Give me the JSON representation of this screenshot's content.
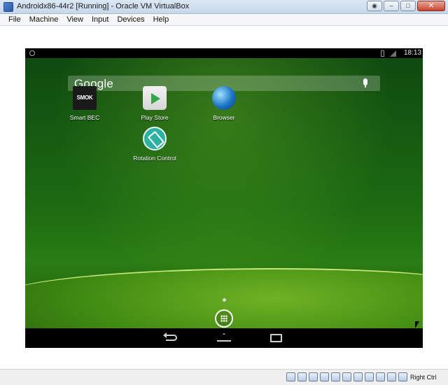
{
  "window": {
    "title": "Androidx86-44r2 [Running] - Oracle VM VirtualBox",
    "buttons": [
      "restore-icon",
      "minimize-icon",
      "maximize-icon",
      "close-icon"
    ]
  },
  "menubar": {
    "items": [
      "File",
      "Machine",
      "View",
      "Input",
      "Devices",
      "Help"
    ]
  },
  "android": {
    "status_bar": {
      "time": "18:13"
    },
    "search": {
      "logo_text": "Google"
    },
    "apps": [
      {
        "label": "Smart BEC",
        "icon_text": "SMOK",
        "icon": "smok-icon"
      },
      {
        "label": "Play Store",
        "icon": "play-store-icon"
      },
      {
        "label": "Browser",
        "icon": "browser-icon"
      },
      {
        "label": "Rotation Control",
        "icon": "rotation-control-icon"
      }
    ],
    "nav": [
      "back-icon",
      "home-icon",
      "recent-apps-icon"
    ]
  },
  "statusbar": {
    "host_key": "Right Ctrl",
    "tray_icons": [
      "hard-disk-icon",
      "optical-drive-icon",
      "audio-icon",
      "network-icon",
      "usb-icon",
      "shared-folders-icon",
      "display-icon",
      "recording-icon",
      "cpu-icon",
      "mouse-integration-icon",
      "keyboard-icon"
    ]
  }
}
